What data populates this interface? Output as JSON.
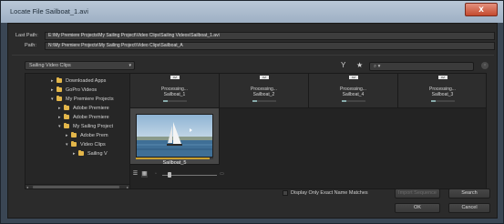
{
  "window": {
    "title": "Locate File Sailboat_1.avi",
    "close_label": "x"
  },
  "paths": {
    "last_path_label": "Last Path:",
    "last_path_value": "E:\\My Premiere Projects\\My Sailing Project\\Video Clips\\Sailing Videos\\Sailboat_1.avi",
    "path_label": "Path:",
    "path_value": "N:\\My Premiere Projects\\My Sailing Project\\Video Clips\\Sailboat_A"
  },
  "location_dropdown": {
    "selected": "Sailing Video Clips",
    "arrow": "▾"
  },
  "toolbar": {
    "filter_icon": "Y",
    "star_icon": "★",
    "search_glass": "⌕",
    "search_placeholder": "▾",
    "clear_icon": "×"
  },
  "tree": {
    "items": [
      {
        "label": "Downloaded Apps",
        "depth": 2,
        "expander": "▸"
      },
      {
        "label": "GoPro Videos",
        "depth": 2,
        "expander": "▸"
      },
      {
        "label": "My Premiere Projects",
        "depth": 2,
        "expander": "▾"
      },
      {
        "label": "Adobe Premiere",
        "depth": 3,
        "expander": "▸"
      },
      {
        "label": "Adobe Premiere",
        "depth": 3,
        "expander": "▸"
      },
      {
        "label": "My Sailing Project",
        "depth": 3,
        "expander": "▾"
      },
      {
        "label": "Adobe Prem",
        "depth": 4,
        "expander": "▸"
      },
      {
        "label": "Video Clips",
        "depth": 4,
        "expander": "▾"
      },
      {
        "label": "Sailing V",
        "depth": 5,
        "expander": "▸"
      }
    ]
  },
  "grid": {
    "cells": [
      {
        "badge": "AVI",
        "status": "Processing...",
        "name": "Sailboat_1",
        "progress": 0.2
      },
      {
        "badge": "AVI",
        "status": "Processing...",
        "name": "Sailboat_2",
        "progress": 0.2
      },
      {
        "badge": "AVI",
        "status": "Processing...",
        "name": "Sailboat_4",
        "progress": 0.2
      },
      {
        "badge": "AVI",
        "status": "Processing...",
        "name": "Sailboat_3",
        "progress": 0.2
      }
    ],
    "selected": {
      "name": "Sailboat_5",
      "progress": 0.95
    }
  },
  "view_controls": {
    "list_icon": "☰",
    "icon_view_icon": "▦",
    "zoom_small": "▫",
    "zoom_large": "▭",
    "zoom_level": 0.1
  },
  "actions": {
    "exact_match_label": "Display Only Exact Name Matches",
    "exact_match_checked": false,
    "import_label": "Import Sequence",
    "search_label": "Search",
    "ok_label": "OK",
    "cancel_label": "Cancel"
  },
  "colors": {
    "accent_folder": "#e3b64a",
    "close_red": "#c44a2f",
    "progress_gold": "#c8a030"
  }
}
